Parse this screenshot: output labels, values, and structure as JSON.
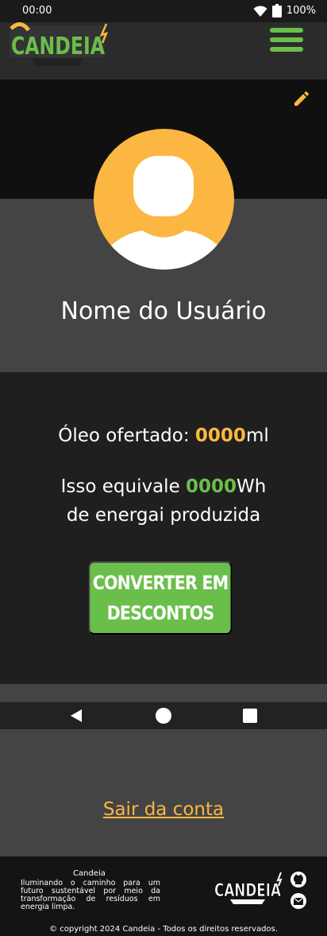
{
  "status_bar": {
    "time": "00:00",
    "battery": "100%"
  },
  "header": {
    "logo_text": "CANDEIA",
    "menu_icon": "hamburger-menu-icon"
  },
  "profile": {
    "edit_icon": "pencil-icon",
    "avatar_icon": "user-avatar-icon",
    "user_name": "Nome do Usuário"
  },
  "stats": {
    "oil_label": "Óleo ofertado: ",
    "oil_value": "0000",
    "oil_unit": "ml",
    "energy_prefix": "Isso equivale ",
    "energy_value": "0000",
    "energy_unit": "Wh",
    "energy_suffix": "de energai produzida",
    "convert_button_line1": "CONVERTER EM",
    "convert_button_line2": "DESCONTOS"
  },
  "account": {
    "logout_label": "Sair da conta"
  },
  "footer": {
    "brand": "Candeia",
    "tagline": "Iluminando o caminho para um futuro sustentável por meio da transformação de resíduos em energia limpa.",
    "logo_text": "CANDEIA",
    "copyright": "© copyright 2024 Candeia - Todos os direitos reservados."
  },
  "colors": {
    "accent_yellow": "#fbb741",
    "accent_green": "#6abf4b"
  }
}
